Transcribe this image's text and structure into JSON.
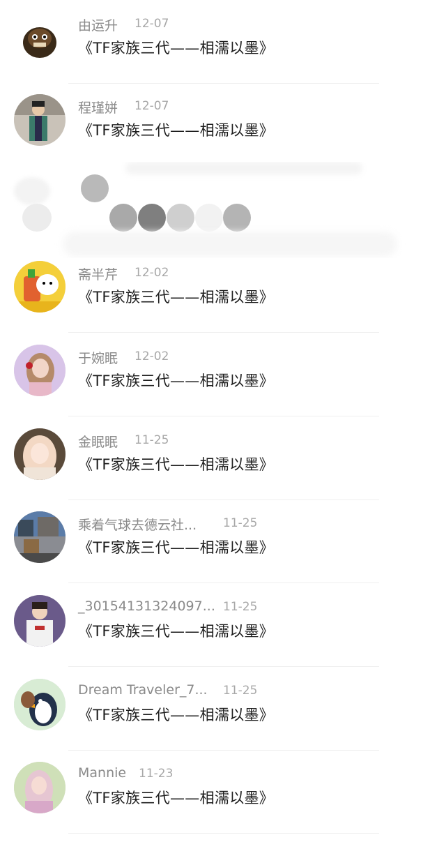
{
  "rows": [
    {
      "name": "由运升",
      "date": "12-07",
      "message": "《TF家族三代——相濡以墨》",
      "avatar_icon": "monster-avatar-icon"
    },
    {
      "name": "程瑾姘",
      "date": "12-07",
      "message": "《TF家族三代——相濡以墨》",
      "avatar_icon": "person-avatar-icon"
    },
    {
      "name": "斋半芹",
      "date": "12-02",
      "message": "《TF家族三代——相濡以墨》",
      "avatar_icon": "cartoon-avatar-icon"
    },
    {
      "name": "于婉眠",
      "date": "12-02",
      "message": "《TF家族三代——相濡以墨》",
      "avatar_icon": "girl-avatar-icon"
    },
    {
      "name": "金眠眠",
      "date": "11-25",
      "message": "《TF家族三代——相濡以墨》",
      "avatar_icon": "girl-avatar-icon"
    },
    {
      "name": "乘着气球去德云社...",
      "date": "11-25",
      "message": "《TF家族三代——相濡以墨》",
      "avatar_icon": "street-avatar-icon"
    },
    {
      "name": "_30154131324097...",
      "date": "11-25",
      "message": "《TF家族三代——相濡以墨》",
      "avatar_icon": "person-avatar-icon"
    },
    {
      "name": "Dream Traveler_7...",
      "date": "11-25",
      "message": "《TF家族三代——相濡以墨》",
      "avatar_icon": "penguin-avatar-icon"
    },
    {
      "name": "Mannie",
      "date": "11-23",
      "message": "《TF家族三代——相濡以墨》",
      "avatar_icon": "girl-avatar-icon"
    }
  ],
  "colors": {
    "name": "#8a8a8a",
    "date": "#a8a8a8",
    "message": "#1d1d1d",
    "divider": "#efefef"
  }
}
